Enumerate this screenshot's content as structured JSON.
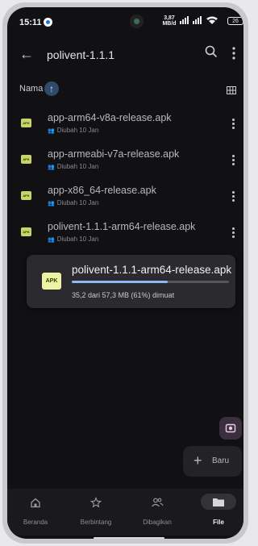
{
  "status_bar": {
    "time": "15:11",
    "net_speed_value": "3,87",
    "net_speed_unit": "MB/d",
    "battery": "26"
  },
  "app_bar": {
    "title": "polivent-1.1.1"
  },
  "sort": {
    "label": "Nama",
    "direction": "ascending"
  },
  "files": [
    {
      "name": "app-arm64-v8a-release.apk",
      "meta": "Diubah 10 Jan",
      "badge": "APK"
    },
    {
      "name": "app-armeabi-v7a-release.apk",
      "meta": "Diubah 10 Jan",
      "badge": "APK"
    },
    {
      "name": "app-x86_64-release.apk",
      "meta": "Diubah 10 Jan",
      "badge": "APK"
    },
    {
      "name": "polivent-1.1.1-arm64-release.apk",
      "meta": "Diubah 10 Jan",
      "badge": "APK"
    }
  ],
  "download": {
    "badge": "APK",
    "file_name": "polivent-1.1.1-arm64-release.apk",
    "status": "35,2 dari 57,3 MB (61%) dimuat",
    "progress": 0.61
  },
  "fab": {
    "label": "Baru"
  },
  "bottom_nav": {
    "items": [
      {
        "label": "Beranda",
        "icon": "home-icon"
      },
      {
        "label": "Berbintang",
        "icon": "star-icon"
      },
      {
        "label": "Dibagikan",
        "icon": "shared-people-icon"
      },
      {
        "label": "File",
        "icon": "folder-icon",
        "active": true
      }
    ]
  },
  "colors": {
    "background": "#111114",
    "apk_badge": "#c8d36a",
    "progress": "#8fb8f5",
    "sort_button": "#2f4a6b"
  }
}
